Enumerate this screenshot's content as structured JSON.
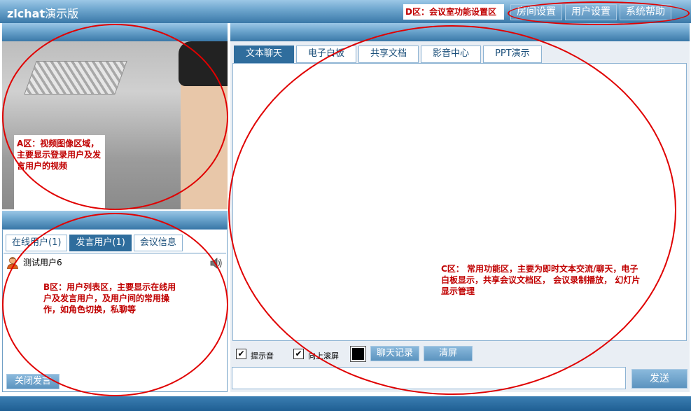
{
  "app": {
    "title": "zlchat演示版",
    "title_bold": "zlchat",
    "title_rest": "演示版"
  },
  "top_buttons": [
    "房间设置",
    "用户设置",
    "系统帮助"
  ],
  "annotations": {
    "d": "D区：会议室功能设置区",
    "a": "A区：视频图像区域，主要显示登录用户及发言用户的视频",
    "b": "B区：用户列表区，主要显示在线用户及发言用户，及用户间的常用操作，如角色切换，私聊等",
    "c": "C区： 常用功能区，主要为即时文本交流/聊天，电子白板显示，共享会议文档区， 会议录制播放， 幻灯片显示管理"
  },
  "user_tabs": [
    {
      "label": "在线用户(1)",
      "active": false
    },
    {
      "label": "发言用户(1)",
      "active": true
    },
    {
      "label": "会议信息",
      "active": false
    }
  ],
  "users": [
    {
      "name": "测试用户6"
    }
  ],
  "close_speak_label": "关闭发言",
  "main_tabs": [
    {
      "label": "文本聊天",
      "active": true
    },
    {
      "label": "电子白板",
      "active": false
    },
    {
      "label": "共享文档",
      "active": false
    },
    {
      "label": "影音中心",
      "active": false
    },
    {
      "label": "PPT演示",
      "active": false
    }
  ],
  "chat_toolbar": {
    "sound_label": "提示音",
    "scroll_label": "向上滚屏",
    "history_label": "聊天记录",
    "clear_label": "清屏",
    "text_color": "#000000"
  },
  "send_label": "发送",
  "colors": {
    "annotation_red": "#e00000",
    "bar_blue": "#3c7bab"
  }
}
